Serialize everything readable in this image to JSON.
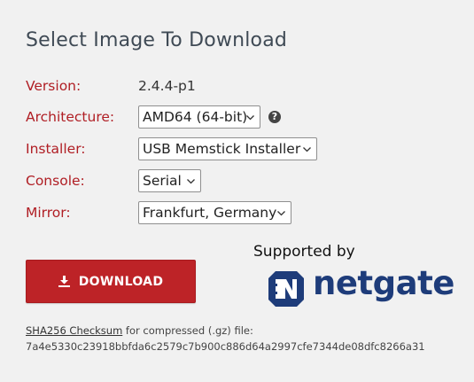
{
  "title": "Select Image To Download",
  "form": {
    "version": {
      "label": "Version:",
      "value": "2.4.4-p1"
    },
    "architecture": {
      "label": "Architecture:",
      "value": "AMD64 (64-bit)"
    },
    "installer": {
      "label": "Installer:",
      "value": "USB Memstick Installer"
    },
    "console": {
      "label": "Console:",
      "value": "Serial"
    },
    "mirror": {
      "label": "Mirror:",
      "value": "Frankfurt, Germany"
    }
  },
  "help_icon_glyph": "?",
  "download_button": {
    "label": "DOWNLOAD",
    "icon": "download-icon",
    "color": "#bd2327"
  },
  "sponsor": {
    "text": "Supported by",
    "logo_text": "netgate",
    "logo_color": "#1e3c7a",
    "logo_icon": "netgate-logo-icon"
  },
  "checksum": {
    "link_label": "SHA256 Checksum",
    "suffix": " for compressed (.gz) file:",
    "hash": "7a4e5330c23918bbfda6c2579c7b900c886d64a2997cfe7344de08dfc8266a31"
  },
  "colors": {
    "label": "#b01e24",
    "title": "#3f4a55",
    "background": "#f1f1f1"
  }
}
